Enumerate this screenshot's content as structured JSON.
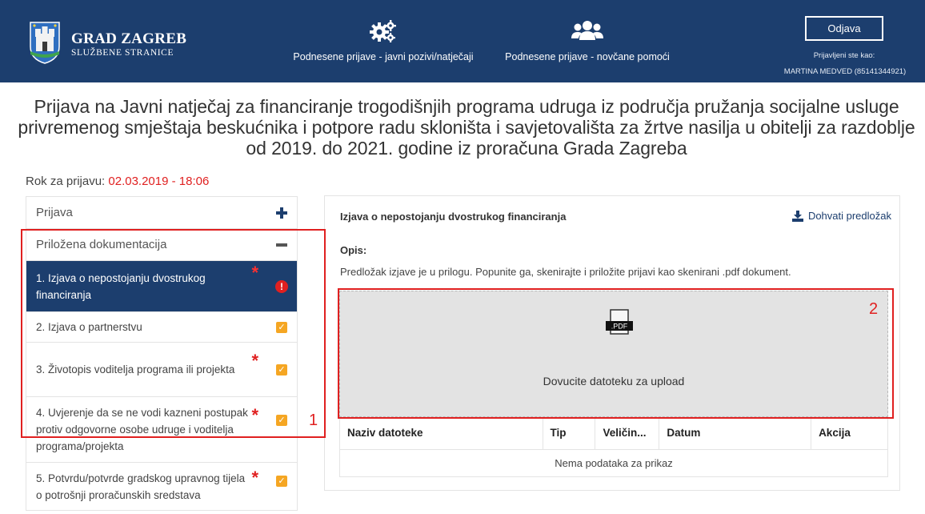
{
  "header": {
    "brand_title": "GRAD ZAGREB",
    "brand_subtitle": "SLUŽBENE STRANICE",
    "nav": [
      {
        "label": "Podnesene prijave - javni pozivi/natječaji",
        "icon": "gears-icon"
      },
      {
        "label": "Podnesene prijave - novčane pomoći",
        "icon": "users-icon"
      }
    ],
    "logout_label": "Odjava",
    "logged_in_label": "Prijavljeni ste kao:",
    "logged_in_user": "MARTINA MEDVED (85141344921)"
  },
  "page": {
    "title": "Prijava na Javni natječaj za financiranje trogodišnjih programa udruga iz područja pružanja socijalne usluge privremenog smještaja beskućnika i potpore radu skloništa i savjetovališta za žrtve nasilja u obitelji za razdoblje od 2019. do 2021. godine iz proračuna Grada Zagreba",
    "deadline_label": "Rok za prijavu:",
    "deadline_value": "02.03.2019 - 18:06"
  },
  "sidebar": {
    "section_prijava": "Prijava",
    "section_docs": "Priložena dokumentacija",
    "items": [
      {
        "label": "1. Izjava o nepostojanju dvostrukog financiranja",
        "required": true,
        "status": "error",
        "active": true
      },
      {
        "label": "2. Izjava o partnerstvu",
        "required": false,
        "status": "ok",
        "active": false
      },
      {
        "label": "3. Životopis voditelja programa ili projekta",
        "required": true,
        "status": "ok",
        "active": false
      },
      {
        "label": "4. Uvjerenje da se ne vodi kazneni postupak protiv odgovorne osobe udruge i voditelja programa/projekta",
        "required": true,
        "status": "ok",
        "active": false
      },
      {
        "label": "5. Potvrdu/potvrde gradskog upravnog tijela o potrošnji proračunskih sredstava",
        "required": true,
        "status": "ok",
        "active": false
      }
    ]
  },
  "panel": {
    "title": "Izjava o nepostojanju dvostrukog financiranja",
    "download_label": "Dohvati predložak",
    "opis_label": "Opis:",
    "opis_text": "Predložak izjave je u prilogu. Popunite ga, skenirajte i priložite prijavi kao skenirani .pdf dokument.",
    "dropzone_text": "Dovucite datoteku za upload",
    "pdf_icon_label": ".PDF",
    "table_headers": [
      "Naziv datoteke",
      "Tip",
      "Veličin...",
      "Datum",
      "Akcija"
    ],
    "empty_text": "Nema podataka za prikaz"
  },
  "annotations": [
    "1",
    "2"
  ],
  "colors": {
    "header_bg": "#1c3e6e",
    "accent_red": "#e02020",
    "check_orange": "#f5a623"
  }
}
